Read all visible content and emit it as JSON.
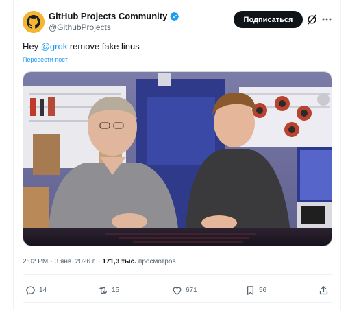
{
  "account": {
    "display_name": "GitHub Projects Community",
    "handle": "@GithubProjects",
    "verified": true
  },
  "header": {
    "subscribe_label": "Подписаться",
    "grok_icon": "grok-icon",
    "more_icon": "more-dots-icon"
  },
  "tweet": {
    "text_before": "Hey ",
    "mention": "@grok",
    "text_after": " remove fake linus",
    "translate_label": "Перевести пост"
  },
  "meta": {
    "time": "2:02 PM",
    "separator": "·",
    "date": "3 янв. 2026 г.",
    "views_count": "171,3 тыс.",
    "views_label": "просмотров"
  },
  "actions": {
    "replies": "14",
    "reposts": "15",
    "likes": "671",
    "bookmarks": "56"
  },
  "colors": {
    "accent": "#1d9bf0",
    "text": "#0f1419",
    "muted": "#536471",
    "verified": "#1d9bf0",
    "avatar_bg": "#f2b632"
  }
}
